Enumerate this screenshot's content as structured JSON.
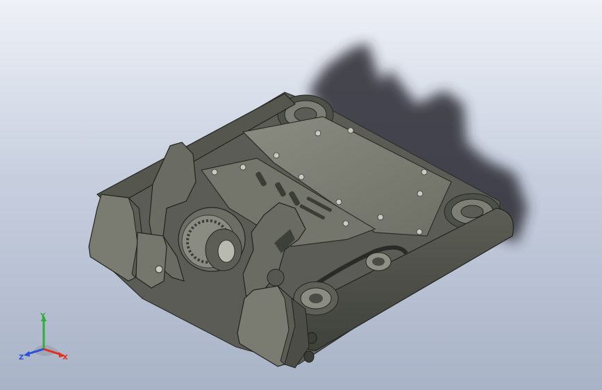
{
  "viewport": {
    "background_top": "#eef1f7",
    "background_bottom": "#a9b3c7",
    "model_color": "#6b6d63",
    "shadow_color": "#2a2c30"
  },
  "triad": {
    "x_label": "X",
    "y_label": "Y",
    "z_label": "Z",
    "x_color": "#e0301e",
    "y_color": "#2fae3a",
    "z_color": "#2b4fd8"
  }
}
